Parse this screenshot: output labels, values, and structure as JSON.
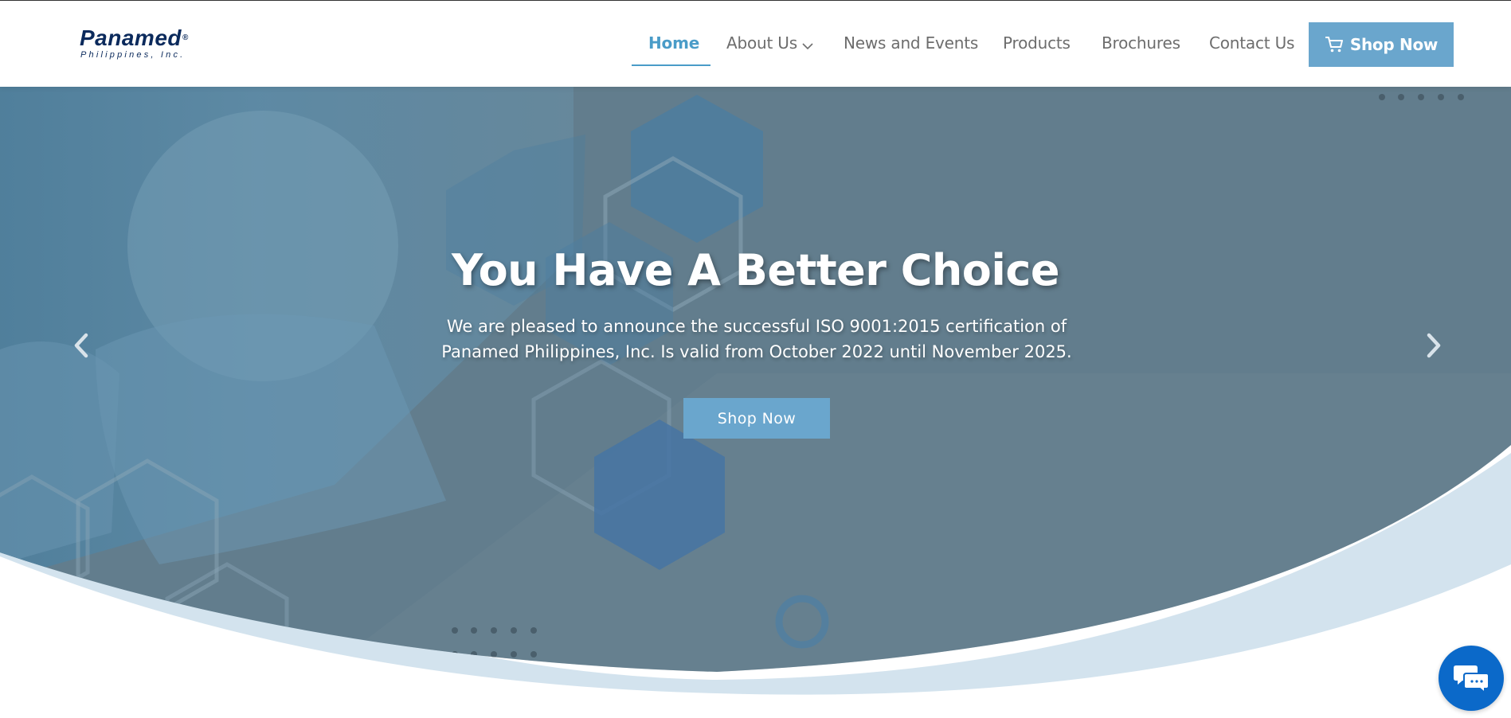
{
  "brand": {
    "name": "Panamed",
    "registered_mark": "®",
    "subtitle": "Philippines, Inc."
  },
  "nav": {
    "items": [
      {
        "label": "Home",
        "active": true
      },
      {
        "label": "About Us",
        "has_dropdown": true
      },
      {
        "label": "News and Events"
      },
      {
        "label": "Products"
      },
      {
        "label": "Brochures"
      },
      {
        "label": "Contact Us"
      }
    ],
    "shop_button": {
      "label": "Shop Now",
      "icon": "cart-icon"
    }
  },
  "hero": {
    "title": "You Have A Better Choice",
    "text": "We are pleased to announce the successful ISO 9001:2015 certification of Panamed Philippines, Inc. Is valid from October 2022 until November 2025.",
    "button_label": "Shop Now",
    "prev_icon": "chevron-left-icon",
    "next_icon": "chevron-right-icon"
  },
  "chat_widget": {
    "icon": "chat-bubbles-icon"
  },
  "colors": {
    "accent": "#4a9cc8",
    "button": "#6aa6cd",
    "hero_overlay": "#5f7f92",
    "wave_light": "#d3e3ee",
    "brand_navy": "#0b2a5c",
    "chat": "#0b69c9"
  }
}
